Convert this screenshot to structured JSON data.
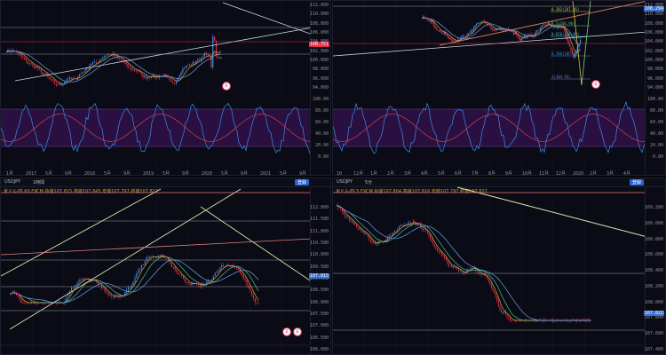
{
  "panes": {
    "tl": {
      "y_labels": [
        "112.000",
        "110.000",
        "108.000",
        "106.000",
        "104.000",
        "102.000",
        "100.000",
        "98.000",
        "96.000",
        "94.000"
      ],
      "x_labels": [
        "1月",
        "2017",
        "5月",
        "9月",
        "2018",
        "5月",
        "9月",
        "2019",
        "5月",
        "9月",
        "2020",
        "5月",
        "9月",
        "2021",
        "5月",
        "9月"
      ],
      "osc_labels": [
        "100.00",
        "80.00",
        "60.00",
        "40.00",
        "20.00",
        "0.00"
      ],
      "price_tag": "108.751"
    },
    "tr": {
      "y_labels": [
        "112.000",
        "110.000",
        "108.000",
        "106.000",
        "104.000",
        "102.000",
        "100.000",
        "98.000",
        "96.000",
        "94.000"
      ],
      "x_labels": [
        "10",
        "12月",
        "1月",
        "2月",
        "3月",
        "4月",
        "5月",
        "6月",
        "7月",
        "8月",
        "9月",
        "10月",
        "11月",
        "12月",
        "2020",
        "2月",
        "3月",
        "4月"
      ],
      "osc_labels": [
        "100.00",
        "80.00",
        "60.00",
        "40.00",
        "20.00",
        "0.00"
      ],
      "price_tag": "108.294",
      "fib_labels": [
        "0.382(107.46)",
        "0.5(106.98)",
        "0.618(106.48)",
        "0.786(105.80)",
        "1(104.93)"
      ]
    },
    "bl": {
      "symbol": "USDJPY",
      "interval": "1時間",
      "legend": "米ドル/円 60 FXCM 始値107.815 高値107.845 安値107.797 終値107.822",
      "button": "登録",
      "y_labels": [
        "112.000",
        "111.500",
        "111.000",
        "110.500",
        "110.000",
        "109.500",
        "109.000",
        "108.500",
        "108.000",
        "107.500",
        "107.000",
        "106.500",
        "106.000"
      ],
      "price_tag": "107.815"
    },
    "br": {
      "symbol": "USDJPY",
      "interval": "5分",
      "legend": "米ドル/円 5 FXCM 始値107.804 高値107.816 安値107.797 終値107.822",
      "button": "登録",
      "y_labels": [
        "109.200",
        "109.000",
        "108.800",
        "108.600",
        "108.400",
        "108.200",
        "108.000",
        "107.800",
        "107.600",
        "107.400"
      ],
      "price_tag": "107.822"
    }
  },
  "colors": {
    "bull": "#3a8df0",
    "bear": "#e0304a",
    "ma1": "#e8a030",
    "ma2": "#40c0a0",
    "ma3": "#6aa0f0",
    "osc_bg": "#2a1040",
    "osc_line": "#3a8df0",
    "osc_line2": "#d04050"
  }
}
